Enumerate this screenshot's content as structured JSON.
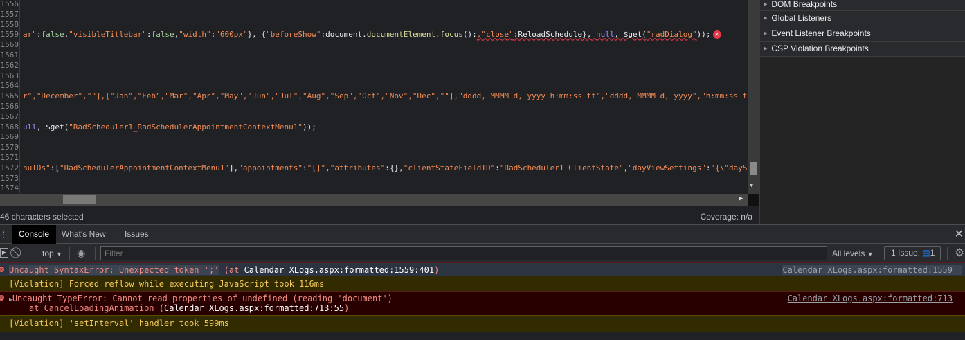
{
  "editor": {
    "lines": [
      {
        "num": "1556",
        "segs": []
      },
      {
        "num": "1557",
        "segs": []
      },
      {
        "num": "1558",
        "segs": []
      },
      {
        "num": "1559",
        "error": true,
        "segs": [
          {
            "t": "ar\"",
            "c": "s"
          },
          {
            "t": ":",
            "c": "p"
          },
          {
            "t": "false",
            "c": "k"
          },
          {
            "t": ",",
            "c": "p"
          },
          {
            "t": "\"visibleTitlebar\"",
            "c": "s"
          },
          {
            "t": ":",
            "c": "p"
          },
          {
            "t": "false",
            "c": "k"
          },
          {
            "t": ",",
            "c": "p"
          },
          {
            "t": "\"width\"",
            "c": "s"
          },
          {
            "t": ":",
            "c": "p"
          },
          {
            "t": "\"600px\"",
            "c": "s"
          },
          {
            "t": "}, {",
            "c": "p"
          },
          {
            "t": "\"beforeShow\"",
            "c": "s"
          },
          {
            "t": ":document.",
            "c": "p"
          },
          {
            "t": "documentElement",
            "c": "f"
          },
          {
            "t": ".",
            "c": "p"
          },
          {
            "t": "focus",
            "c": "f"
          },
          {
            "t": "();",
            "c": "p"
          },
          {
            "t": ",\"close\"",
            "c": "s sq"
          },
          {
            "t": ":ReloadSchedule}, ",
            "c": "p sq"
          },
          {
            "t": "null",
            "c": "n sq"
          },
          {
            "t": ", $get(",
            "c": "p sq"
          },
          {
            "t": "\"radDialog\"",
            "c": "s sq"
          },
          {
            "t": "));",
            "c": "p"
          }
        ]
      },
      {
        "num": "1560",
        "segs": []
      },
      {
        "num": "1561",
        "segs": []
      },
      {
        "num": "1562",
        "segs": []
      },
      {
        "num": "1563",
        "segs": []
      },
      {
        "num": "1564",
        "segs": []
      },
      {
        "num": "1565",
        "segs": [
          {
            "t": "r\",\"December\",\"\"],[\"Jan\",\"Feb\",\"Mar\",\"Apr\",\"May\",\"Jun\",\"Jul\",\"Aug\",\"Sep\",\"Oct\",\"Nov\",\"Dec\",\"\"],\"dddd, MMMM d, yyyy h:mm:ss tt\",\"dddd, MMMM d, yyyy\",\"h:mm:ss tt\"",
            "c": "s"
          }
        ]
      },
      {
        "num": "1566",
        "segs": []
      },
      {
        "num": "1567",
        "segs": []
      },
      {
        "num": "1568",
        "segs": [
          {
            "t": "ull",
            "c": "n"
          },
          {
            "t": ", $get(",
            "c": "p"
          },
          {
            "t": "\"RadScheduler1_RadSchedulerAppointmentContextMenu1\"",
            "c": "s"
          },
          {
            "t": "));",
            "c": "p"
          }
        ]
      },
      {
        "num": "1569",
        "segs": []
      },
      {
        "num": "1570",
        "segs": []
      },
      {
        "num": "1571",
        "segs": []
      },
      {
        "num": "1572",
        "segs": [
          {
            "t": "nuIDs\"",
            "c": "s"
          },
          {
            "t": ":[",
            "c": "p"
          },
          {
            "t": "\"RadSchedulerAppointmentContextMenu1\"",
            "c": "s"
          },
          {
            "t": "],",
            "c": "p"
          },
          {
            "t": "\"appointments\"",
            "c": "s"
          },
          {
            "t": ":",
            "c": "p"
          },
          {
            "t": "\"[]\"",
            "c": "s"
          },
          {
            "t": ",",
            "c": "p"
          },
          {
            "t": "\"attributes\"",
            "c": "s"
          },
          {
            "t": ":{},",
            "c": "p"
          },
          {
            "t": "\"clientStateFieldID\"",
            "c": "s"
          },
          {
            "t": ":",
            "c": "p"
          },
          {
            "t": "\"RadScheduler1_ClientState\"",
            "c": "s"
          },
          {
            "t": ",",
            "c": "p"
          },
          {
            "t": "\"dayViewSettings\"",
            "c": "s"
          },
          {
            "t": ":",
            "c": "p"
          },
          {
            "t": "\"{\\\"daySta",
            "c": "s"
          }
        ]
      },
      {
        "num": "1573",
        "segs": []
      },
      {
        "num": "1574",
        "segs": []
      }
    ]
  },
  "status": {
    "selection": "46 characters selected",
    "coverage": "Coverage: n/a"
  },
  "sidebar": {
    "sections": [
      "DOM Breakpoints",
      "Global Listeners",
      "Event Listener Breakpoints",
      "CSP Violation Breakpoints"
    ]
  },
  "drawer": {
    "tabs": [
      "Console",
      "What's New",
      "Issues"
    ],
    "toolbar": {
      "context": "top",
      "filter_placeholder": "Filter",
      "levels": "All levels",
      "issues_label": "1 Issue:",
      "issues_count": "1"
    },
    "messages": [
      {
        "type": "error",
        "text": "Uncaught SyntaxError: Unexpected token ';'",
        "pre": " (at ",
        "link": "Calendar XLogs.aspx:formatted:1559:401",
        "post": ")",
        "source": "Calendar XLogs.aspx:formatted:1559"
      },
      {
        "type": "violation",
        "text": "[Violation] Forced reflow while executing JavaScript took 116ms"
      },
      {
        "type": "error",
        "text": "Uncaught TypeError: Cannot read properties of undefined (reading 'document')",
        "line2": "    at CancelLoadingAnimation (",
        "link": "Calendar XLogs.aspx:formatted:713:55",
        "post": ")",
        "source": "Calendar XLogs.aspx:formatted:713"
      },
      {
        "type": "violation",
        "text": "[Violation] 'setInterval' handler took 599ms"
      }
    ]
  },
  "colors": {
    "error_bg": "#290000",
    "error_text": "#f28b82",
    "violation_bg": "#332b00",
    "violation_text": "#f2c95e",
    "selected_bg": "#2c3442"
  }
}
